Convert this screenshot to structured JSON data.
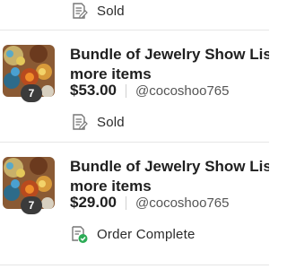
{
  "top_status": {
    "icon": "receipt-icon",
    "label": "Sold"
  },
  "listings": [
    {
      "title_line1": "Bundle of Jewelry Show Listing a",
      "title_line2": "more items",
      "bundle_count": "7",
      "price": "$53.00",
      "seller": "@cocoshoo765",
      "status": {
        "icon": "receipt-icon",
        "label": "Sold"
      }
    },
    {
      "title_line1": "Bundle of Jewelry Show Listing a",
      "title_line2": "more items",
      "bundle_count": "7",
      "price": "$29.00",
      "seller": "@cocoshoo765",
      "status": {
        "icon": "order-complete-icon",
        "label": "Order Complete",
        "badge_color": "#2bab55"
      }
    }
  ]
}
